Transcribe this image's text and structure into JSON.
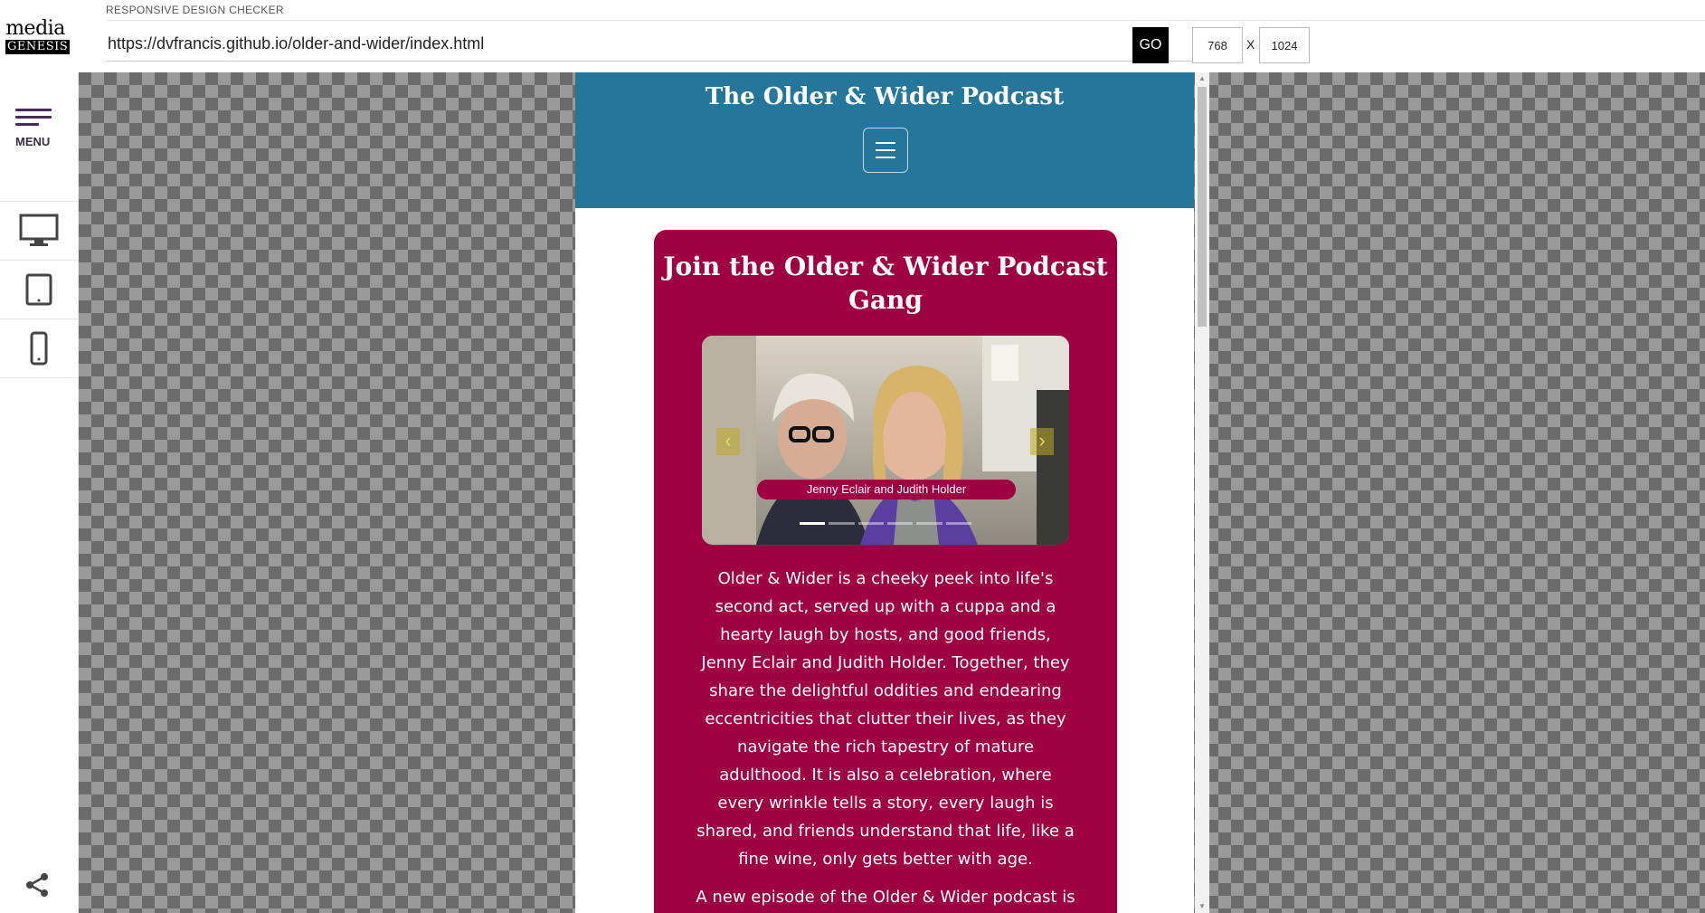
{
  "sidebar": {
    "logo_top": "media",
    "logo_bottom": "GENESIS",
    "menu_label": "MENU",
    "devices": [
      "desktop",
      "tablet",
      "mobile"
    ]
  },
  "toolbar": {
    "app_title": "RESPONSIVE DESIGN CHECKER",
    "url": "https://dvfrancis.github.io/older-and-wider/index.html",
    "go_label": "GO",
    "width": "768",
    "x_label": "X",
    "height": "1024"
  },
  "site": {
    "title": "The Older & Wider Podcast",
    "card_heading": "Join the Older & Wider Podcast Gang",
    "carousel_caption": "Jenny Eclair and Judith Holder",
    "carousel_slides": 6,
    "carousel_active": 1,
    "intro_text": "Older & Wider is a cheeky peek into life's second act, served up with a cuppa and a hearty laugh by hosts, and good friends, Jenny Eclair and Judith Holder. Together, they share the delightful oddities and endearing eccentricities that clutter their lives, as they navigate the rich tapestry of mature adulthood. It is also a celebration, where every wrinkle tells a story, every laugh is shared, and friends understand that life, like a fine wine, only gets better with age.",
    "next_text": "A new episode of the Older & Wider podcast is"
  },
  "colors": {
    "header_blue": "#24779b",
    "card_magenta": "#9e0041",
    "sidebar_purple": "#4a2a5c"
  },
  "icons": {
    "prev": "chevron-left-icon",
    "next": "chevron-right-icon",
    "share": "share-icon"
  }
}
